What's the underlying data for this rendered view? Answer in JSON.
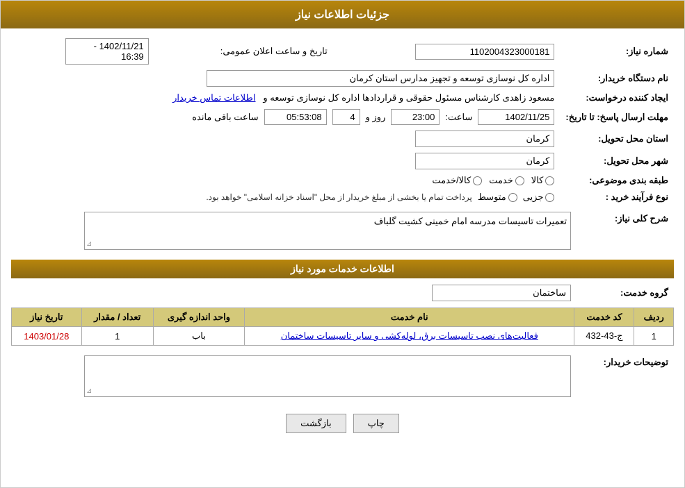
{
  "header": {
    "title": "جزئیات اطلاعات نیاز"
  },
  "fields": {
    "tender_number_label": "شماره نیاز:",
    "tender_number_value": "1102004323000181",
    "buyer_org_label": "نام دستگاه خریدار:",
    "buyer_org_value": "اداره کل نوسازی  توسعه و تجهیز مدارس استان کرمان",
    "creator_label": "ایجاد کننده درخواست:",
    "creator_value": "مسعود زاهدی کارشناس مسئول حقوقی و قراردادها اداره کل نوسازی  توسعه و",
    "creator_link": "اطلاعات تماس خریدار",
    "deadline_label": "مهلت ارسال پاسخ: تا تاریخ:",
    "deadline_date": "1402/11/25",
    "deadline_time_label": "ساعت:",
    "deadline_time": "23:00",
    "deadline_days_label": "روز و",
    "deadline_days": "4",
    "remain_time_label": "ساعت باقی مانده",
    "remain_time": "05:53:08",
    "announce_label": "تاریخ و ساعت اعلان عمومی:",
    "announce_value": "1402/11/21 - 16:39",
    "province_label": "استان محل تحویل:",
    "province_value": "کرمان",
    "city_label": "شهر محل تحویل:",
    "city_value": "کرمان",
    "subject_label": "طبقه بندی موضوعی:",
    "subject_radio1": "کالا",
    "subject_radio2": "خدمت",
    "subject_radio3": "کالا/خدمت",
    "purchase_type_label": "نوع فرآیند خرید :",
    "purchase_radio1": "جزیی",
    "purchase_radio2": "متوسط",
    "purchase_notice": "پرداخت تمام یا بخشی از مبلغ خریدار از محل \"اسناد خزانه اسلامی\" خواهد بود.",
    "description_label": "شرح کلی نیاز:",
    "description_value": "تعمیرات تاسیسات مدرسه امام خمینی کشیت گلباف"
  },
  "services_section": {
    "title": "اطلاعات خدمات مورد نیاز",
    "service_group_label": "گروه خدمت:",
    "service_group_value": "ساختمان",
    "table": {
      "headers": [
        "ردیف",
        "کد خدمت",
        "نام خدمت",
        "واحد اندازه گیری",
        "تعداد / مقدار",
        "تاریخ نیاز"
      ],
      "rows": [
        {
          "row_num": "1",
          "service_code": "ج-43-432",
          "service_name": "فعالیت‌های نصب تاسیسات برق، لوله‌کشی و سایر تاسیسات ساختمان",
          "unit": "باب",
          "quantity": "1",
          "date": "1403/01/28"
        }
      ]
    }
  },
  "buyer_notes_label": "توضیحات خریدار:",
  "buttons": {
    "print": "چاپ",
    "back": "بازگشت"
  }
}
